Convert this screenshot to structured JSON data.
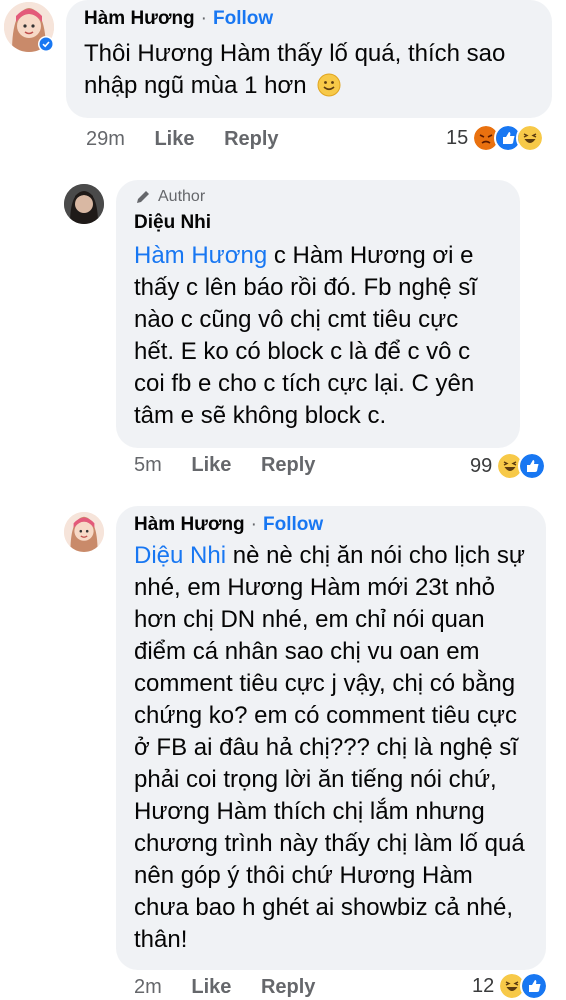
{
  "comments": [
    {
      "author": "Hàm Hương",
      "follow_label": "Follow",
      "text": "Thôi Hương Hàm thấy lố quá, thích sao nhập ngũ mùa 1 hơn",
      "time": "29m",
      "like_label": "Like",
      "reply_label": "Reply",
      "reaction_count": "15",
      "reactions": [
        "angry-icon",
        "like-icon",
        "haha-icon"
      ]
    },
    {
      "badge": "Author",
      "author": "Diệu Nhi",
      "mention": "Hàm Hương",
      "text": "c Hàm Hương ơi e thấy c lên báo rồi đó. Fb nghệ sĩ nào c cũng vô chị cmt tiêu cực hết. E ko có block c là để c vô c coi fb e cho c tích cực lại. C yên tâm e sẽ không block c.",
      "time": "5m",
      "like_label": "Like",
      "reply_label": "Reply",
      "reaction_count": "99",
      "reactions": [
        "haha-icon",
        "like-icon"
      ]
    },
    {
      "author": "Hàm Hương",
      "follow_label": "Follow",
      "mention": "Diệu Nhi",
      "text": "nè nè chị ăn nói cho lịch sự nhé, em Hương Hàm mới 23t nhỏ hơn chị DN nhé, em chỉ nói quan điểm cá nhân sao chị vu oan em comment tiêu cực j vậy, chị có bằng chứng ko? em có comment tiêu cực ở FB ai đâu hả chị??? chị là nghệ sĩ phải coi trọng lời ăn tiếng nói chứ, Hương Hàm thích chị lắm nhưng chương trình này thấy chị làm lố quá nên góp ý thôi chứ Hương Hàm chưa bao h ghét ai showbiz cả nhé, thân!",
      "time": "2m",
      "like_label": "Like",
      "reply_label": "Reply",
      "reaction_count": "12",
      "reactions": [
        "haha-icon",
        "like-icon"
      ]
    }
  ],
  "colors": {
    "link": "#1877f2",
    "bubble": "#f0f2f5",
    "muted": "#65676b"
  }
}
